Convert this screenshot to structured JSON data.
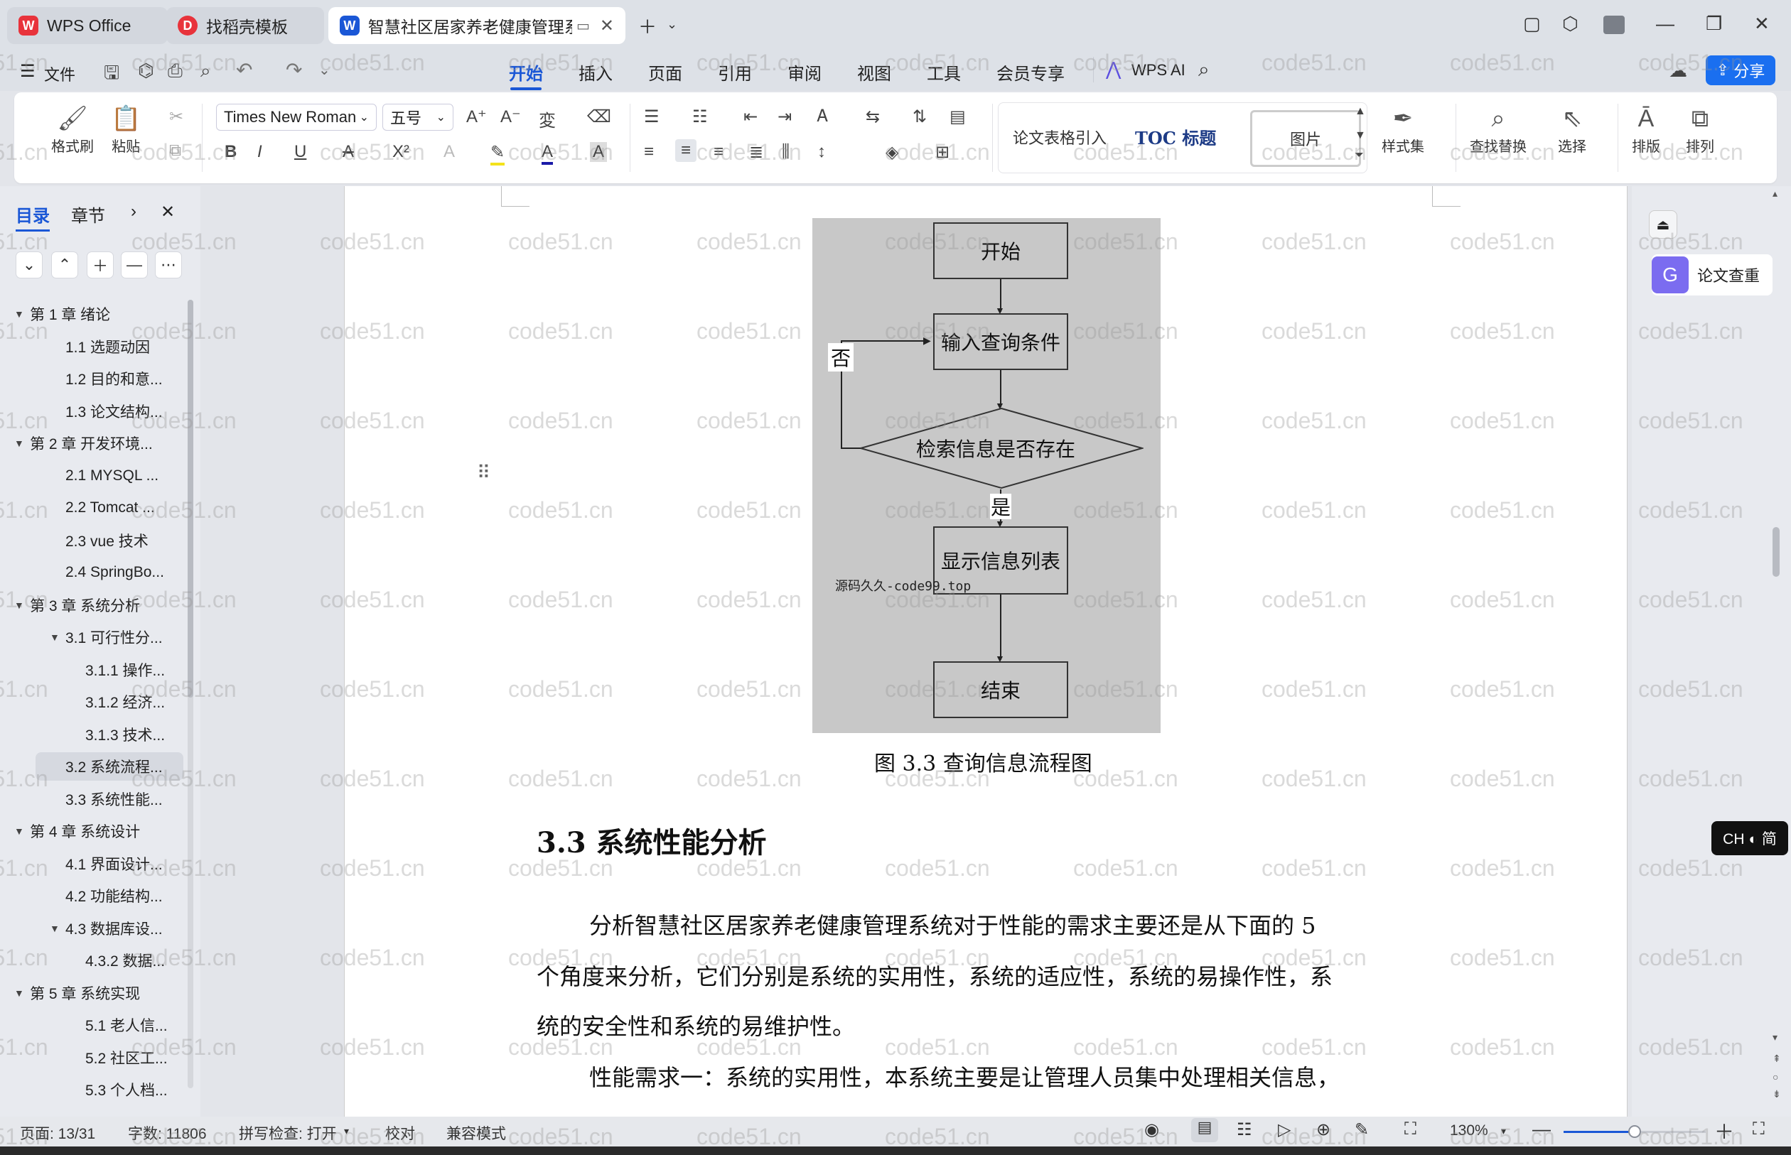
{
  "tabs": [
    {
      "label": "WPS Office",
      "logo": "W"
    },
    {
      "label": "找稻壳模板",
      "logo": "D"
    },
    {
      "label": "智慧社区居家养老健康管理系",
      "logo": "W"
    }
  ],
  "menu": {
    "file_label": "文件",
    "items": [
      "开始",
      "插入",
      "页面",
      "引用",
      "审阅",
      "视图",
      "工具",
      "会员专享"
    ],
    "wps_ai": "WPS AI",
    "share": "分享"
  },
  "ribbon": {
    "format_painter": "格式刷",
    "paste": "粘贴",
    "font_name": "Times New Roman",
    "font_size": "五号",
    "styles": [
      "论文表格引入",
      "TOC 标题",
      "图片"
    ],
    "style_set": "样式集",
    "find_replace": "查找替换",
    "select": "选择",
    "layout": "排版",
    "arrange": "排列"
  },
  "nav": {
    "tab_toc": "目录",
    "tab_chapter": "章节",
    "items": [
      {
        "label": "第 1 章  绪论",
        "level": 0,
        "arrow": "▼"
      },
      {
        "label": "1.1 选题动因",
        "level": 1
      },
      {
        "label": "1.2 目的和意...",
        "level": 1
      },
      {
        "label": "1.3 论文结构...",
        "level": 1
      },
      {
        "label": "第 2 章  开发环境...",
        "level": 0,
        "arrow": "▼"
      },
      {
        "label": "2.1 MYSQL ...",
        "level": 1
      },
      {
        "label": "2.2 Tomcat ...",
        "level": 1
      },
      {
        "label": "2.3 vue 技术",
        "level": 1
      },
      {
        "label": "2.4 SpringBo...",
        "level": 1
      },
      {
        "label": "第 3 章  系统分析",
        "level": 0,
        "arrow": "▼"
      },
      {
        "label": "3.1 可行性分...",
        "level": 1,
        "arrow": "▼"
      },
      {
        "label": "3.1.1 操作...",
        "level": 2
      },
      {
        "label": "3.1.2 经济...",
        "level": 2
      },
      {
        "label": "3.1.3 技术...",
        "level": 2
      },
      {
        "label": "3.2 系统流程...",
        "level": 1,
        "selected": true
      },
      {
        "label": "3.3 系统性能...",
        "level": 1
      },
      {
        "label": "第 4 章  系统设计",
        "level": 0,
        "arrow": "▼"
      },
      {
        "label": "4.1 界面设计...",
        "level": 1
      },
      {
        "label": "4.2 功能结构...",
        "level": 1
      },
      {
        "label": "4.3 数据库设...",
        "level": 1,
        "arrow": "▼"
      },
      {
        "label": "4.3.2 数据...",
        "level": 2
      },
      {
        "label": "第 5 章  系统实现",
        "level": 0,
        "arrow": "▼"
      },
      {
        "label": "5.1 老人信...",
        "level": 2
      },
      {
        "label": "5.2 社区工...",
        "level": 2
      },
      {
        "label": "5.3 个人档...",
        "level": 2
      }
    ]
  },
  "flowchart": {
    "start": "开始",
    "input": "输入查询条件",
    "decision": "检索信息是否存在",
    "no": "否",
    "yes": "是",
    "display": "显示信息列表",
    "end": "结束",
    "watermark": "源码久久-code99.top"
  },
  "document": {
    "caption": "图 3.3  查询信息流程图",
    "heading": "3.3 系统性能分析",
    "para1_line1": "分析智慧社区居家养老健康管理系统对于性能的需求主要还是从下面的 5",
    "para1_line2": "个角度来分析，它们分别是系统的实用性，系统的适应性，系统的易操作性，系",
    "para1_line3": "统的安全性和系统的易维护性。",
    "para2_line1": "性能需求一：系统的实用性，本系统主要是让管理人员集中处理相关信息，"
  },
  "right_panel": {
    "paper_check": "论文查重",
    "ime": "CH ◐ 简"
  },
  "status": {
    "page": "页面: 13/31",
    "words": "字数: 11806",
    "spell": "拼写检查: 打开",
    "proof": "校对",
    "compat": "兼容模式",
    "zoom": "130%",
    "zoom_level": 0.5
  },
  "watermark_text": "code51.cn",
  "colors": {
    "accent": "#1a57d6",
    "wps_red": "#e8333b",
    "flow_bg": "#c8c8c8"
  }
}
